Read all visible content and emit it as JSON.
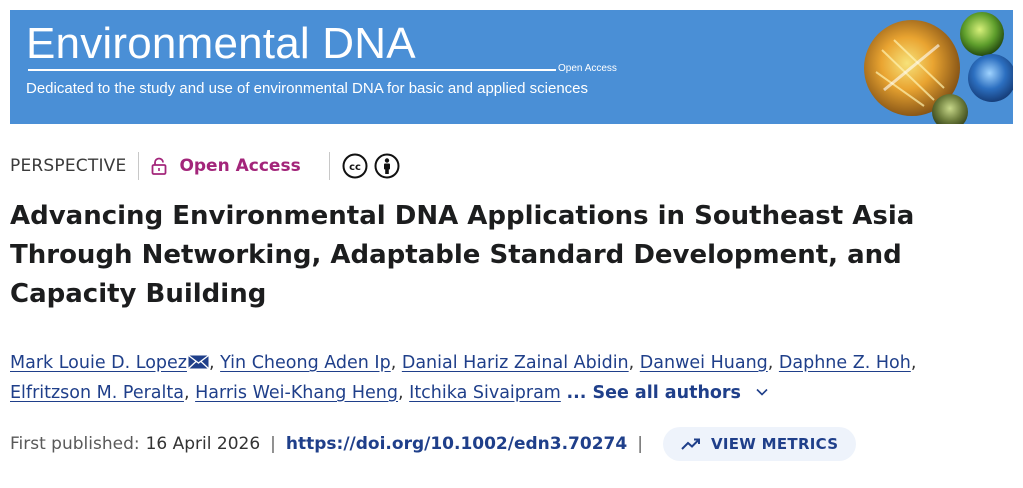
{
  "journal": {
    "title": "Environmental DNA",
    "open_access_tag": "Open Access",
    "tagline": "Dedicated to the study and use of environmental DNA for basic and applied sciences",
    "banner_color": "#4a8fd6"
  },
  "meta": {
    "article_type": "PERSPECTIVE",
    "open_access_label": "Open Access",
    "lock_icon": "lock-icon",
    "license_icons": [
      "cc-icon",
      "attribution-icon"
    ],
    "accent_color": "#a3257a"
  },
  "article": {
    "title": "Advancing Environmental DNA Applications in Southeast Asia Through Networking, Adaptable Standard Development, and Capacity Building"
  },
  "authors": {
    "list": [
      "Mark Louie D. Lopez",
      "Yin Cheong Aden Ip",
      "Danial Hariz Zainal Abidin",
      "Danwei Huang",
      "Daphne Z. Hoh",
      "Elfritzson M. Peralta",
      "Harris Wei-Khang Heng",
      "Itchika Sivaipram"
    ],
    "see_all_label": "... See all authors",
    "link_color": "#1f3f8a"
  },
  "publication": {
    "first_published_label": "First published:",
    "date": "16 April 2026",
    "separator": "|",
    "doi": "https://doi.org/10.1002/edn3.70274",
    "metrics_label": "VIEW METRICS"
  }
}
